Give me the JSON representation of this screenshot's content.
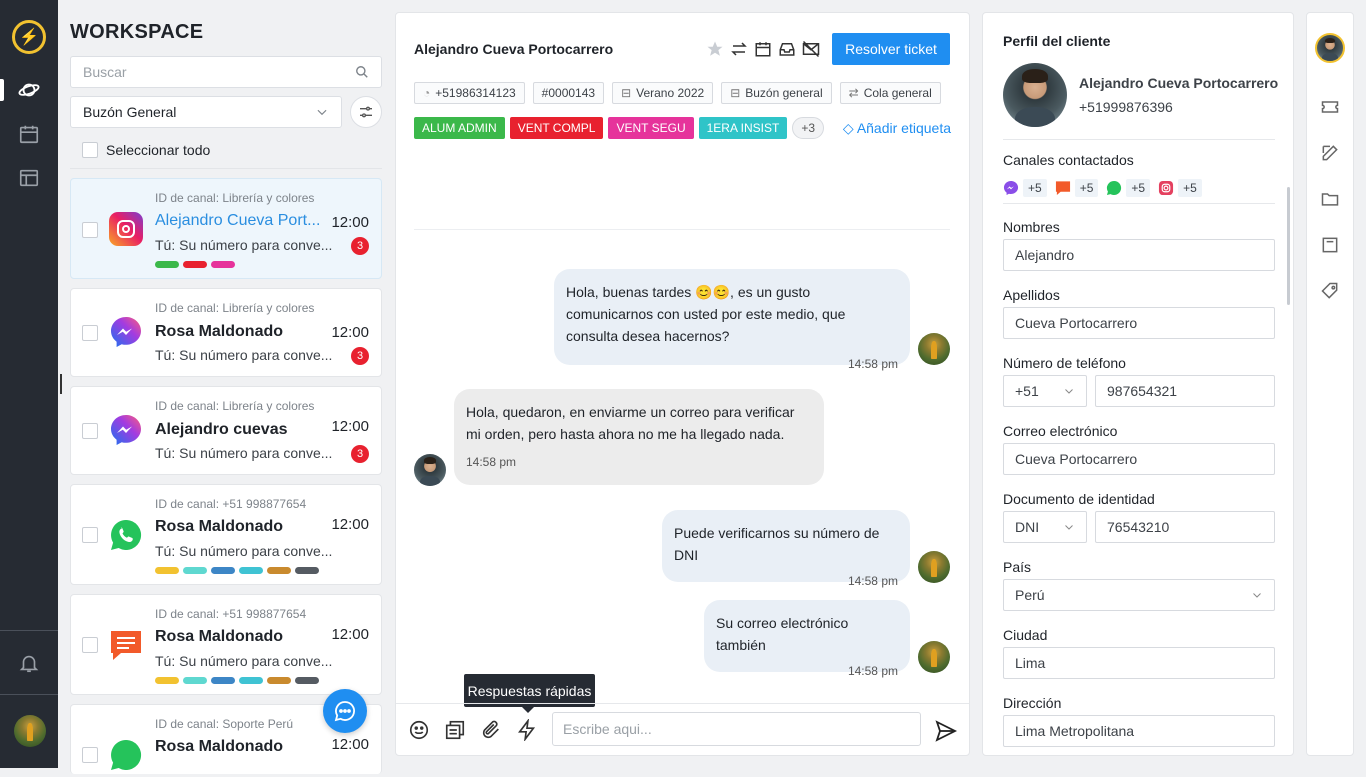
{
  "workspace": {
    "title": "WORKSPACE",
    "search_placeholder": "Buscar",
    "mailbox_selected": "Buzón General",
    "select_all_label": "Seleccionar todo"
  },
  "conversations": [
    {
      "channel_id": "ID de canal: Librería y colores",
      "name": "Alejandro Cueva Port...",
      "time": "12:00",
      "preview": "Tú: Su número para conve...",
      "unread": "3",
      "channel": "instagram",
      "tag_colors": [
        "#3bb84a",
        "#e8212f",
        "#e6339b"
      ]
    },
    {
      "channel_id": "ID de canal: Librería y colores",
      "name": "Rosa Maldonado",
      "time": "12:00",
      "preview": "Tú: Su número para conve...",
      "unread": "3",
      "channel": "messenger",
      "tag_colors": []
    },
    {
      "channel_id": "ID de canal: Librería y colores",
      "name": "Alejandro cuevas",
      "time": "12:00",
      "preview": "Tú: Su número para conve...",
      "unread": "3",
      "channel": "messenger",
      "tag_colors": []
    },
    {
      "channel_id": "ID de canal: +51 998877654",
      "name": "Rosa Maldonado",
      "time": "12:00",
      "preview": "Tú: Su número para conve...",
      "unread": "",
      "channel": "whatsapp",
      "tag_colors": [
        "#f2c230",
        "#5fd8d0",
        "#3d86c6",
        "#3fc3d3",
        "#c98a2e",
        "#555b62"
      ]
    },
    {
      "channel_id": "ID de canal: +51 998877654",
      "name": "Rosa Maldonado",
      "time": "12:00",
      "preview": "Tú: Su número para conve...",
      "unread": "",
      "channel": "sms",
      "tag_colors": [
        "#f2c230",
        "#5fd8d0",
        "#3d86c6",
        "#3fc3d3",
        "#c98a2e",
        "#555b62"
      ]
    },
    {
      "channel_id": "ID de canal: Soporte Perú",
      "name": "Rosa Maldonado",
      "time": "12:00",
      "preview": "",
      "unread": "",
      "channel": "whatsapp",
      "tag_colors": []
    }
  ],
  "chat": {
    "contact_name": "Alejandro Cueva Portocarrero",
    "resolve_label": "Resolver ticket",
    "pills": [
      "+51986314123",
      "#0000143",
      "Verano 2022",
      "Buzón general",
      "Cola general"
    ],
    "labels": [
      {
        "text": "ALUM ADMIN",
        "color": "#3bb84a"
      },
      {
        "text": "VENT COMPL",
        "color": "#e8212f"
      },
      {
        "text": "VENT SEGU",
        "color": "#e6339b"
      },
      {
        "text": "1ERA INSIST",
        "color": "#2fc4c8"
      }
    ],
    "more_labels": "+3",
    "add_tag_label": "Añadir etiqueta",
    "messages": [
      {
        "dir": "out",
        "text": "Hola, buenas tardes 😊😊, es un gusto comunicarnos con usted por este medio, que consulta desea hacernos?",
        "time": "14:58 pm"
      },
      {
        "dir": "in",
        "text": "Hola, quedaron, en enviarme un correo para verificar mi orden, pero hasta ahora no me ha llegado nada.",
        "time": "14:58 pm"
      },
      {
        "dir": "out",
        "text": "Puede verificarnos su número de DNI",
        "time": "14:58 pm"
      },
      {
        "dir": "out",
        "text": "Su correo electrónico también",
        "time": "14:58 pm"
      }
    ],
    "tooltip": "Respuestas rápidas",
    "composer_placeholder": "Escribe aqui..."
  },
  "profile": {
    "title": "Perfil del cliente",
    "name": "Alejandro Cueva Portocarrero",
    "phone": "+51999876396",
    "channels_label": "Canales contactados",
    "channels": [
      {
        "icon": "messenger-icon",
        "count": "+5"
      },
      {
        "icon": "sms-icon",
        "count": "+5"
      },
      {
        "icon": "whatsapp-icon",
        "count": "+5"
      },
      {
        "icon": "instagram-icon",
        "count": "+5"
      }
    ],
    "first_name_label": "Nombres",
    "first_name": "Alejandro",
    "last_name_label": "Apellidos",
    "last_name": "Cueva Portocarrero",
    "phone_label": "Número de teléfono",
    "phone_code": "+51",
    "phone_number": "987654321",
    "email_label": "Correo electrónico",
    "email": "Cueva Portocarrero",
    "doc_label": "Documento de identidad",
    "doc_type": "DNI",
    "doc_number": "76543210",
    "country_label": "País",
    "country": "Perú",
    "city_label": "Ciudad",
    "city": "Lima",
    "address_label": "Dirección",
    "address": "Lima Metropolitana"
  }
}
